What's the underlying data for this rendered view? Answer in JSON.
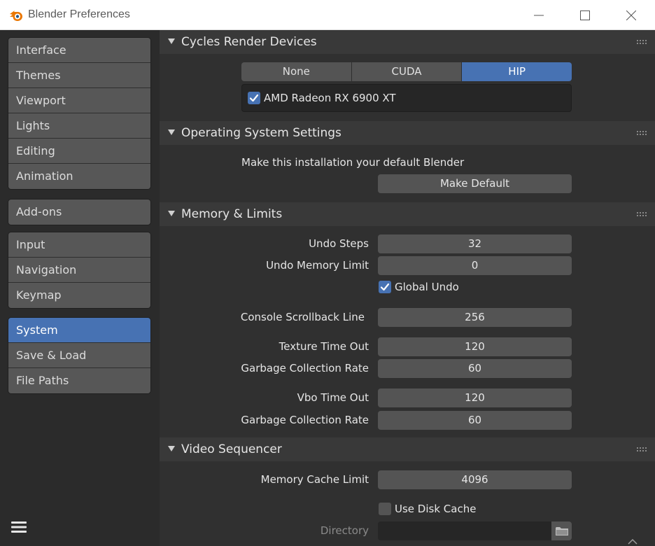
{
  "window": {
    "title": "Blender Preferences",
    "controls": [
      "minimize-icon",
      "maximize-icon",
      "close-icon"
    ]
  },
  "sidebar": {
    "groups": [
      {
        "items": [
          {
            "label": "Interface",
            "active": false
          },
          {
            "label": "Themes",
            "active": false
          },
          {
            "label": "Viewport",
            "active": false
          },
          {
            "label": "Lights",
            "active": false
          },
          {
            "label": "Editing",
            "active": false
          },
          {
            "label": "Animation",
            "active": false
          }
        ]
      },
      {
        "items": [
          {
            "label": "Add-ons",
            "active": false
          }
        ]
      },
      {
        "items": [
          {
            "label": "Input",
            "active": false
          },
          {
            "label": "Navigation",
            "active": false
          },
          {
            "label": "Keymap",
            "active": false
          }
        ]
      },
      {
        "items": [
          {
            "label": "System",
            "active": true
          },
          {
            "label": "Save & Load",
            "active": false
          },
          {
            "label": "File Paths",
            "active": false
          }
        ]
      }
    ],
    "menu_icon": "hamburger-menu-icon"
  },
  "sections": {
    "cycles": {
      "title": "Cycles Render Devices",
      "options": [
        "None",
        "CUDA",
        "HIP"
      ],
      "selected": "HIP",
      "device": {
        "label": "AMD Radeon RX 6900 XT",
        "checked": true
      }
    },
    "os": {
      "title": "Operating System Settings",
      "description": "Make this installation your default Blender",
      "button": "Make Default"
    },
    "memory": {
      "title": "Memory & Limits",
      "undo_steps": {
        "label": "Undo Steps",
        "value": "32"
      },
      "undo_memory": {
        "label": "Undo Memory Limit",
        "value": "0"
      },
      "global_undo": {
        "label": "Global Undo",
        "checked": true
      },
      "console_scrollback": {
        "label": "Console Scrollback Line",
        "value": "256"
      },
      "texture_timeout": {
        "label": "Texture Time Out",
        "value": "120"
      },
      "texture_gc": {
        "label": "Garbage Collection Rate",
        "value": "60"
      },
      "vbo_timeout": {
        "label": "Vbo Time Out",
        "value": "120"
      },
      "vbo_gc": {
        "label": "Garbage Collection Rate",
        "value": "60"
      }
    },
    "video": {
      "title": "Video Sequencer",
      "memory_cache": {
        "label": "Memory Cache Limit",
        "value": "4096"
      },
      "disk_cache": {
        "label": "Use Disk Cache",
        "checked": false
      },
      "directory": {
        "label": "Directory",
        "value": ""
      }
    }
  },
  "colors": {
    "accent": "#4772b3",
    "panel": "#303030",
    "header": "#393939",
    "widget": "#545454"
  }
}
